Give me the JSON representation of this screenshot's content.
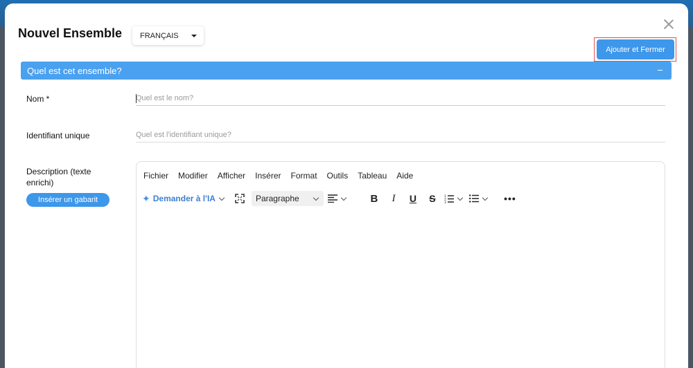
{
  "modal": {
    "title": "Nouvel Ensemble",
    "language": "FRANÇAIS",
    "add_close_label": "Ajouter et Fermer"
  },
  "section": {
    "title": "Quel est cet ensemble?"
  },
  "fields": {
    "name_label": "Nom *",
    "name_placeholder": "Quel est le nom?",
    "id_label": "Identifiant unique",
    "id_placeholder": "Quel est l'identifiant unique?",
    "description_label": "Description (texte enrichi)",
    "template_button": "Insérer un gabarit"
  },
  "editor": {
    "menu": [
      "Fichier",
      "Modifier",
      "Afficher",
      "Insérer",
      "Format",
      "Outils",
      "Tableau",
      "Aide"
    ],
    "ai_label": "Demander à l'IA",
    "block_format": "Paragraphe",
    "bold": "B",
    "italic": "I",
    "underline": "U",
    "strikethrough": "S",
    "more": "•••"
  },
  "colors": {
    "primary": "#3d97ea",
    "section_bar": "#4aa1f0",
    "highlight": "#e05050"
  }
}
